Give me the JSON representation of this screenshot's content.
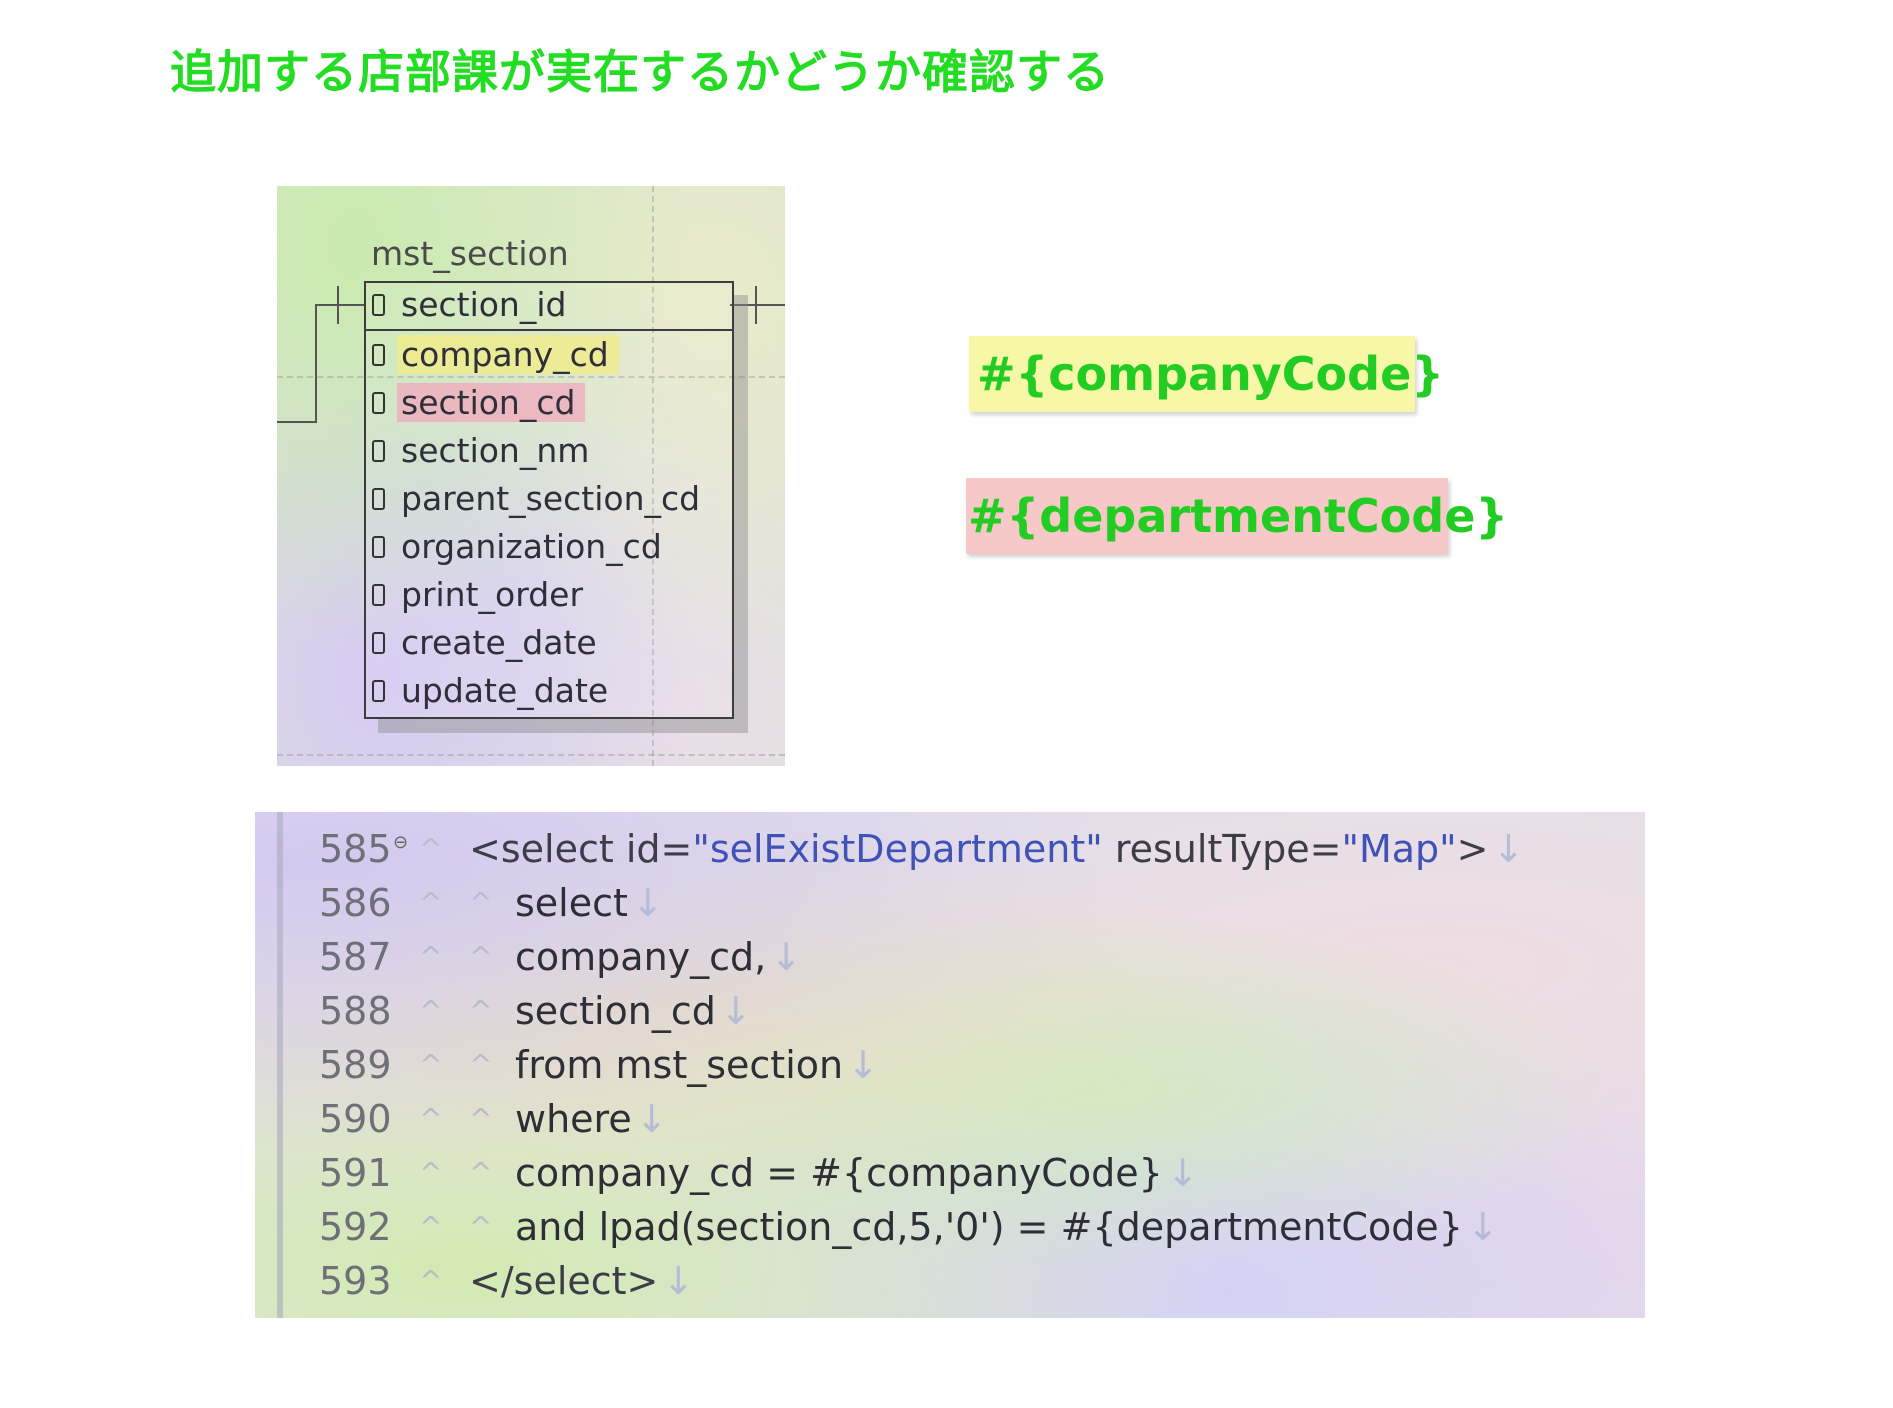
{
  "page_title": "追加する店部課が実在するかどうか確認する",
  "er_diagram": {
    "table_name": "mst_section",
    "columns": [
      {
        "name": "section_id",
        "highlight": "none",
        "key": true
      },
      {
        "name": "company_cd",
        "highlight": "yellow"
      },
      {
        "name": "section_cd",
        "highlight": "red"
      },
      {
        "name": "section_nm",
        "highlight": "none"
      },
      {
        "name": "parent_section_cd",
        "highlight": "none"
      },
      {
        "name": "organization_cd",
        "highlight": "none"
      },
      {
        "name": "print_order",
        "highlight": "none"
      },
      {
        "name": "create_date",
        "highlight": "none"
      },
      {
        "name": "update_date",
        "highlight": "none"
      }
    ],
    "colors": {
      "highlight_yellow": "#f0eb8c",
      "highlight_red": "#eeafbe"
    }
  },
  "params": {
    "company": "#{companyCode}",
    "department": "#{departmentCode}",
    "colors": {
      "text": "#22cc22",
      "company_bg": "#f7f7a8",
      "department_bg": "#f7c8c8"
    }
  },
  "code": {
    "eol_marker": "↓",
    "caret": "^",
    "fold_icon": "⊖",
    "lines": [
      {
        "num": "585",
        "open": "<select id=",
        "id_val": "\"selExistDepartment\"",
        "mid": " resultType=",
        "type_val": "\"Map\"",
        "close": ">"
      },
      {
        "num": "586",
        "text": "select"
      },
      {
        "num": "587",
        "text": "company_cd,"
      },
      {
        "num": "588",
        "text": "section_cd"
      },
      {
        "num": "589",
        "text": "from mst_section"
      },
      {
        "num": "590",
        "text": "where"
      },
      {
        "num": "591",
        "text": "company_cd = #{companyCode}"
      },
      {
        "num": "592",
        "text": "and lpad(section_cd,5,'0') = #{departmentCode}"
      },
      {
        "num": "593",
        "text": "</select>"
      }
    ]
  }
}
